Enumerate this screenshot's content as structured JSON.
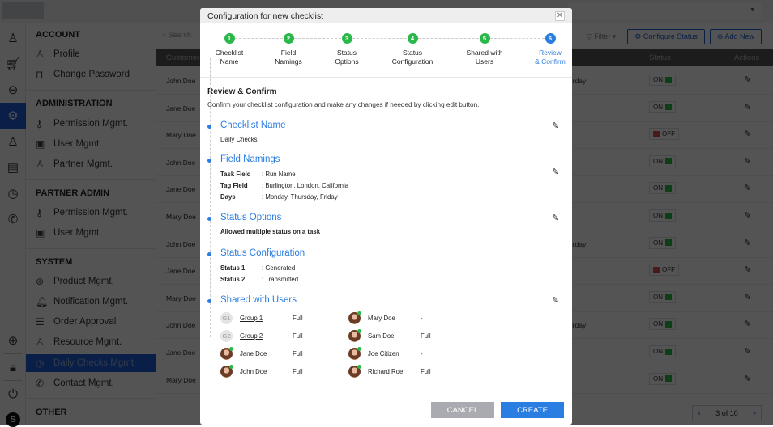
{
  "background": {
    "sidebar": {
      "sections": [
        {
          "title": "ACCOUNT",
          "items": [
            {
              "label": "Profile",
              "icon": "user-icon"
            },
            {
              "label": "Change Password",
              "icon": "lock-icon"
            }
          ]
        },
        {
          "title": "ADMINISTRATION",
          "items": [
            {
              "label": "Permission Mgmt.",
              "icon": "key-icon"
            },
            {
              "label": "User Mgmt.",
              "icon": "id-card-icon"
            },
            {
              "label": "Partner Mgmt.",
              "icon": "partner-icon"
            }
          ]
        },
        {
          "title": "PARTNER ADMIN",
          "items": [
            {
              "label": "Permission Mgmt.",
              "icon": "key-icon"
            },
            {
              "label": "User Mgmt.",
              "icon": "id-card-icon"
            }
          ]
        },
        {
          "title": "SYSTEM",
          "items": [
            {
              "label": "Product Mgmt.",
              "icon": "product-icon"
            },
            {
              "label": "Notification Mgmt.",
              "icon": "bell-icon"
            },
            {
              "label": "Order Approval",
              "icon": "checklist-icon"
            },
            {
              "label": "Resource Mgmt.",
              "icon": "resource-icon"
            },
            {
              "label": "Daily Checks Mgmt.",
              "icon": "calendar-clock-icon",
              "active": true
            },
            {
              "label": "Contact Mgmt.",
              "icon": "phone-icon"
            }
          ]
        },
        {
          "title": "OTHER",
          "items": []
        }
      ],
      "user_initial": "S"
    },
    "search_placeholder": "Search",
    "filter_label": "Filter",
    "configure_status_label": "Configure Status",
    "add_new_label": "Add New",
    "columns": {
      "customer": "Customer",
      "status": "Status",
      "actions": "Actions"
    },
    "rows": [
      {
        "name": "John Doe",
        "extra": "urday",
        "status": "ON"
      },
      {
        "name": "Jane Doe",
        "extra": "",
        "status": "ON"
      },
      {
        "name": "Mary Doe",
        "extra": "",
        "status": "OFF"
      },
      {
        "name": "John Doe",
        "extra": "",
        "status": "ON"
      },
      {
        "name": "Jane Doe",
        "extra": "",
        "status": "ON"
      },
      {
        "name": "Mary Doe",
        "extra": "",
        "status": "ON"
      },
      {
        "name": "John Doe",
        "extra": "urday",
        "status": "ON"
      },
      {
        "name": "Jane Doe",
        "extra": "",
        "status": "OFF"
      },
      {
        "name": "Mary Doe",
        "extra": "",
        "status": "ON"
      },
      {
        "name": "John Doe",
        "extra": "urday",
        "status": "ON"
      },
      {
        "name": "Jane Doe",
        "extra": "",
        "status": "ON"
      },
      {
        "name": "Mary Doe",
        "extra": "",
        "status": "ON"
      }
    ],
    "pager": {
      "label": "3 of 10"
    },
    "colors": {
      "on": "#2bb84a",
      "off": "#d9534f",
      "accent": "#1d5fd6"
    }
  },
  "modal": {
    "title": "Configuration for new checklist",
    "steps": [
      {
        "num": "1",
        "label1": "Checklist",
        "label2": "Name"
      },
      {
        "num": "2",
        "label1": "Field",
        "label2": "Namings"
      },
      {
        "num": "3",
        "label1": "Status",
        "label2": "Options"
      },
      {
        "num": "4",
        "label1": "Status",
        "label2": "Configuration"
      },
      {
        "num": "5",
        "label1": "Shared with",
        "label2": "Users"
      },
      {
        "num": "6",
        "label1": "Review",
        "label2": "& Confirm",
        "current": true
      }
    ],
    "review_title": "Review & Confirm",
    "review_desc": "Confirm your checklist configuration and make any changes if needed by clicking edit button.",
    "checklist_name": {
      "heading": "Checklist Name",
      "value": "Daily Checks"
    },
    "field_namings": {
      "heading": "Field Namings",
      "fields": [
        {
          "key": "Task Field",
          "value": ": Run Name"
        },
        {
          "key": "Tag Field",
          "value": ": Burlington, London, California"
        },
        {
          "key": "Days",
          "value": ": Monday, Thursday, Friday"
        }
      ]
    },
    "status_options": {
      "heading": "Status Options",
      "value": "Allowed multiple status on a task"
    },
    "status_configuration": {
      "heading": "Status Configuration",
      "statuses": [
        {
          "key": "Status 1",
          "value": ": Generated"
        },
        {
          "key": "Status 2",
          "value": ": Transmitted"
        }
      ]
    },
    "shared_with_users": {
      "heading": "Shared with Users",
      "left": [
        {
          "type": "group",
          "initials": "G1",
          "name": "Group 1",
          "access": "Full"
        },
        {
          "type": "group",
          "initials": "G2",
          "name": "Group 2",
          "access": "Full"
        },
        {
          "type": "user",
          "name": "Jane Doe",
          "access": "Full"
        },
        {
          "type": "user",
          "name": "John Doe",
          "access": "Full"
        }
      ],
      "right": [
        {
          "type": "user",
          "name": "Mary Doe",
          "access": "-"
        },
        {
          "type": "user",
          "name": "Sam Doe",
          "access": "Full"
        },
        {
          "type": "user",
          "name": "Joe Citizen",
          "access": "-"
        },
        {
          "type": "user",
          "name": "Richard Roe",
          "access": "Full"
        }
      ]
    },
    "cancel_label": "CANCEL",
    "create_label": "CREATE"
  }
}
